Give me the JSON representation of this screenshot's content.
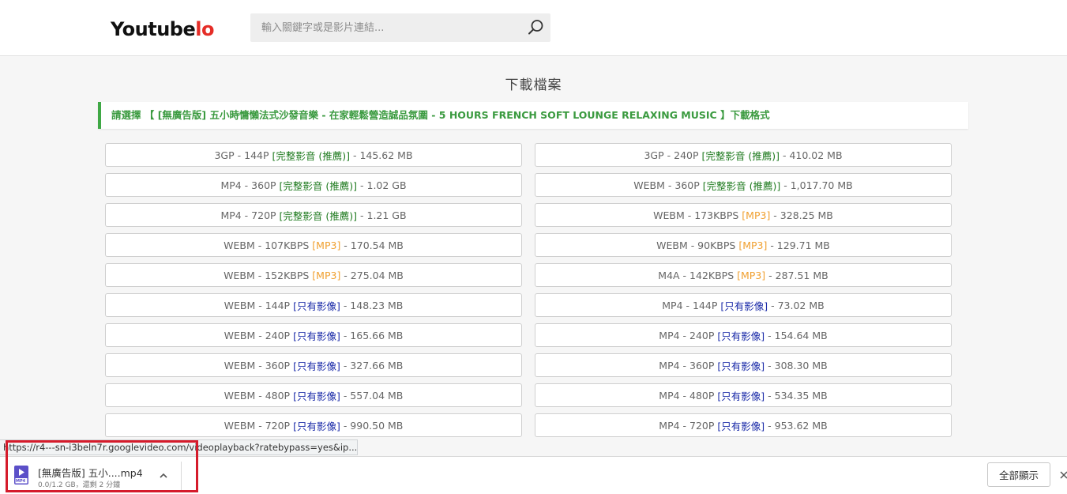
{
  "header": {
    "logo_main": "Youtube",
    "logo_accent": "lo",
    "search_placeholder": "輸入關鍵字或是影片連結..."
  },
  "main": {
    "title": "下載檔案",
    "notice": "請選擇 【 [無廣告版] 五小時慵懶法式沙發音樂 - 在家輕鬆營造誠品氛圍 - 5 HOURS FRENCH SOFT LOUNGE RELAXING MUSIC 】下載格式"
  },
  "formats": [
    {
      "fmt": "3GP - 144P ",
      "tag": "[完整影音 (推薦)]",
      "tag_type": "full",
      "size": " - 145.62 MB"
    },
    {
      "fmt": "3GP - 240P ",
      "tag": "[完整影音 (推薦)]",
      "tag_type": "full",
      "size": " - 410.02 MB"
    },
    {
      "fmt": "MP4 - 360P ",
      "tag": "[完整影音 (推薦)]",
      "tag_type": "full",
      "size": " - 1.02 GB"
    },
    {
      "fmt": "WEBM - 360P ",
      "tag": "[完整影音 (推薦)]",
      "tag_type": "full",
      "size": " - 1,017.70 MB"
    },
    {
      "fmt": "MP4 - 720P ",
      "tag": "[完整影音 (推薦)]",
      "tag_type": "full",
      "size": " - 1.21 GB"
    },
    {
      "fmt": "WEBM - 173KBPS ",
      "tag": "[MP3]",
      "tag_type": "mp3",
      "size": " - 328.25 MB"
    },
    {
      "fmt": "WEBM - 107KBPS ",
      "tag": "[MP3]",
      "tag_type": "mp3",
      "size": " - 170.54 MB"
    },
    {
      "fmt": "WEBM - 90KBPS ",
      "tag": "[MP3]",
      "tag_type": "mp3",
      "size": " - 129.71 MB"
    },
    {
      "fmt": "WEBM - 152KBPS ",
      "tag": "[MP3]",
      "tag_type": "mp3",
      "size": " - 275.04 MB"
    },
    {
      "fmt": "M4A - 142KBPS ",
      "tag": "[MP3]",
      "tag_type": "mp3",
      "size": " - 287.51 MB"
    },
    {
      "fmt": "WEBM - 144P ",
      "tag": "[只有影像]",
      "tag_type": "video",
      "size": " - 148.23 MB"
    },
    {
      "fmt": "MP4 - 144P ",
      "tag": "[只有影像]",
      "tag_type": "video",
      "size": " - 73.02 MB"
    },
    {
      "fmt": "WEBM - 240P ",
      "tag": "[只有影像]",
      "tag_type": "video",
      "size": " - 165.66 MB"
    },
    {
      "fmt": "MP4 - 240P ",
      "tag": "[只有影像]",
      "tag_type": "video",
      "size": " - 154.64 MB"
    },
    {
      "fmt": "WEBM - 360P ",
      "tag": "[只有影像]",
      "tag_type": "video",
      "size": " - 327.66 MB"
    },
    {
      "fmt": "MP4 - 360P ",
      "tag": "[只有影像]",
      "tag_type": "video",
      "size": " - 308.30 MB"
    },
    {
      "fmt": "WEBM - 480P ",
      "tag": "[只有影像]",
      "tag_type": "video",
      "size": " - 557.04 MB"
    },
    {
      "fmt": "MP4 - 480P ",
      "tag": "[只有影像]",
      "tag_type": "video",
      "size": " - 534.35 MB"
    },
    {
      "fmt": "WEBM - 720P ",
      "tag": "[只有影像]",
      "tag_type": "video",
      "size": " - 990.50 MB"
    },
    {
      "fmt": "MP4 - 720P ",
      "tag": "[只有影像]",
      "tag_type": "video",
      "size": " - 953.62 MB"
    }
  ],
  "status_url": "https://r4---sn-i3beln7r.googlevideo.com/videoplayback?ratebypass=yes&ip...",
  "download_bar": {
    "file_name": "[無廣告版] 五小....mp4",
    "file_status": "0.0/1.2 GB，還剩 2 分鐘",
    "show_all_label": "全部顯示",
    "icon_label": "MP4"
  },
  "colors": {
    "accent_green": "#3a9a3f",
    "tag_full": "#1e7a1e",
    "tag_mp3": "#f0a030",
    "tag_video": "#1a2aa8",
    "highlight": "#d51b2b"
  }
}
